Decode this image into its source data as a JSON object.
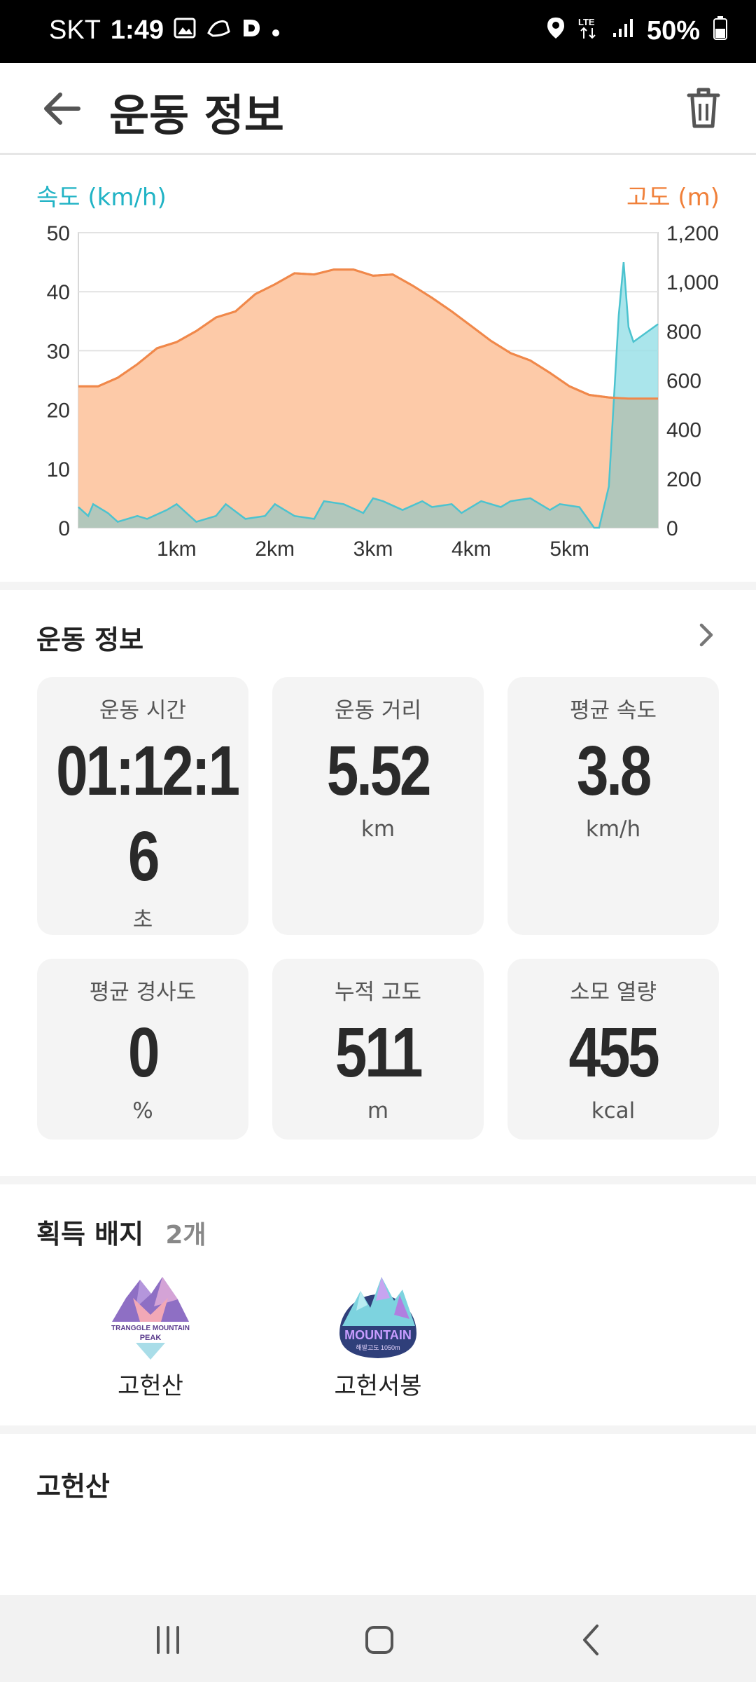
{
  "status_bar": {
    "carrier": "SKT",
    "time": "1:49",
    "network": "LTE",
    "battery": "50%",
    "left_icons": [
      "image-icon",
      "running-shoe-icon",
      "d-app-icon",
      "dot-icon"
    ],
    "right_icons": [
      "location-icon",
      "lte-icon",
      "signal-icon",
      "battery-icon"
    ]
  },
  "app_bar": {
    "title": "운동 정보",
    "back_icon": "arrow-left-icon",
    "delete_icon": "trash-icon"
  },
  "chart_data": {
    "type": "area",
    "left_axis_title": "속도 (km/h)",
    "right_axis_title": "고도 (m)",
    "left_ticks": [
      "0",
      "10",
      "20",
      "30",
      "40",
      "50"
    ],
    "right_ticks": [
      "0",
      "200",
      "400",
      "600",
      "800",
      "1,000",
      "1,200"
    ],
    "x_ticks": [
      "1km",
      "2km",
      "3km",
      "4km",
      "5km"
    ],
    "xlim": [
      0,
      5.9
    ],
    "ylim_left": [
      0,
      50
    ],
    "ylim_right": [
      0,
      1200
    ],
    "grid": true,
    "colors": {
      "speed": "#9be0e8",
      "speed_line": "#4cc3cf",
      "altitude_fill": "#fdcaa8",
      "altitude_line": "#f0884a",
      "overlap": "#b8b59f"
    },
    "series": [
      {
        "axis": "right",
        "x": [
          0,
          0.2,
          0.4,
          0.6,
          0.8,
          1.0,
          1.2,
          1.4,
          1.6,
          1.8,
          2.0,
          2.2,
          2.4,
          2.6,
          2.8,
          3.0,
          3.2,
          3.4,
          3.6,
          3.8,
          4.0,
          4.2,
          4.4,
          4.6,
          4.8,
          5.0,
          5.2,
          5.4,
          5.6,
          5.9
        ],
        "values": [
          575,
          575,
          610,
          665,
          730,
          755,
          800,
          855,
          880,
          950,
          990,
          1035,
          1030,
          1050,
          1050,
          1025,
          1030,
          985,
          935,
          880,
          820,
          760,
          710,
          680,
          630,
          575,
          540,
          530,
          525,
          525
        ]
      },
      {
        "axis": "left",
        "x": [
          0,
          0.1,
          0.15,
          0.3,
          0.4,
          0.6,
          0.7,
          0.9,
          1.0,
          1.2,
          1.4,
          1.5,
          1.7,
          1.9,
          2.0,
          2.2,
          2.4,
          2.5,
          2.7,
          2.9,
          3.0,
          3.1,
          3.3,
          3.5,
          3.6,
          3.8,
          3.9,
          4.1,
          4.3,
          4.4,
          4.6,
          4.8,
          4.9,
          5.1,
          5.25,
          5.3,
          5.4,
          5.5,
          5.55,
          5.6,
          5.65,
          5.9
        ],
        "values": [
          3.5,
          2,
          4,
          2.5,
          1,
          2,
          1.5,
          3,
          4,
          1,
          2,
          4,
          1.5,
          2,
          4,
          2,
          1.5,
          4.5,
          4,
          2.5,
          5,
          4.5,
          3,
          4.5,
          3.5,
          4,
          2.5,
          4.5,
          3.5,
          4.5,
          5,
          3,
          4,
          3.5,
          0,
          0,
          7,
          36,
          45,
          34,
          31.5,
          34.5
        ]
      }
    ]
  },
  "workout": {
    "section_title": "운동 정보",
    "chevron_icon": "chevron-right-icon",
    "stats": [
      {
        "label": "운동 시간",
        "value_line1": "01:12:1",
        "value_line2": "6",
        "unit": "초"
      },
      {
        "label": "운동 거리",
        "value_line1": "5.52",
        "unit": "km"
      },
      {
        "label": "평균 속도",
        "value_line1": "3.8",
        "unit": "km/h"
      },
      {
        "label": "평균 경사도",
        "value_line1": "0",
        "unit": "%"
      },
      {
        "label": "누적 고도",
        "value_line1": "511",
        "unit": "m"
      },
      {
        "label": "소모 열량",
        "value_line1": "455",
        "unit": "kcal"
      }
    ]
  },
  "badges": {
    "section_title": "획득 배지",
    "count": "2개",
    "items": [
      {
        "name": "고헌산",
        "art_text1": "TRANGGLE MOUNTAIN",
        "art_text2": "PEAK",
        "icon": "mountain-peak-badge-icon"
      },
      {
        "name": "고헌서봉",
        "art_text1": "MOUNTAIN",
        "art_text2": "해발고도 1050m",
        "icon": "mountain-badge-icon"
      }
    ]
  },
  "mountain_section": {
    "title": "고헌산"
  },
  "nav_bar": {
    "icons": [
      "recent-apps-icon",
      "home-icon",
      "back-icon"
    ]
  }
}
